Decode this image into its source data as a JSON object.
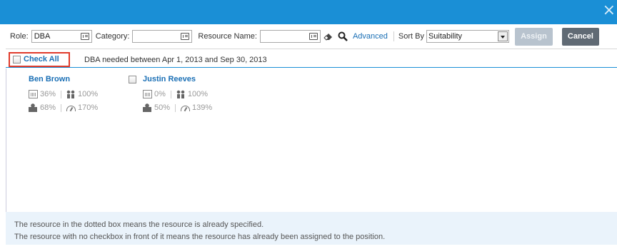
{
  "window": {
    "close_glyph": "×"
  },
  "toolbar": {
    "role_label": "Role:",
    "role_value": "DBA",
    "category_label": "Category:",
    "category_value": "",
    "resource_name_label": "Resource Name:",
    "resource_name_value": "",
    "advanced_label": "Advanced",
    "sort_by_label": "Sort By",
    "sort_by_value": "Suitability",
    "assign_label": "Assign",
    "cancel_label": "Cancel"
  },
  "subbar": {
    "check_all_label": "Check All",
    "needed_text": "DBA needed between Apr 1, 2013 and Sep 30, 2013"
  },
  "resources": [
    {
      "name": "Ben Brown",
      "has_checkbox": false,
      "availability": "36%",
      "team_fit": "100%",
      "skill_match": "68%",
      "load": "170%"
    },
    {
      "name": "Justin Reeves",
      "has_checkbox": true,
      "availability": "0%",
      "team_fit": "100%",
      "skill_match": "50%",
      "load": "139%"
    }
  ],
  "footer": {
    "note_1": "The resource in the dotted box means the resource is already specified.",
    "note_2": "The resource with no checkbox in front of it means the resource has already been assigned to the position."
  },
  "colors": {
    "title_bar": "#1a8fd6",
    "link": "#1a6fb5",
    "highlight_border": "#e03b2b",
    "cancel_button": "#606a74",
    "assign_button_disabled": "#b8c3ce"
  }
}
